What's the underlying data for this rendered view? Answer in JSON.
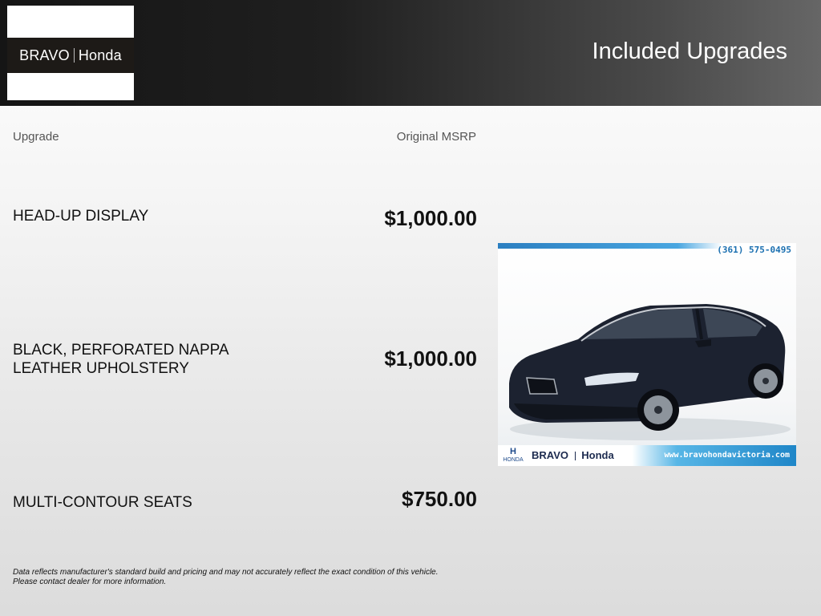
{
  "header": {
    "logo_brand": "BRAVO",
    "logo_make": "Honda",
    "title": "Included Upgrades"
  },
  "table": {
    "col_upgrade": "Upgrade",
    "col_msrp": "Original MSRP",
    "rows": [
      {
        "name_line1": "HEAD-UP DISPLAY",
        "name_line2": "",
        "price": "$1,000.00"
      },
      {
        "name_line1": "BLACK, PERFORATED NAPPA",
        "name_line2": "LEATHER UPHOLSTERY",
        "price": "$1,000.00"
      },
      {
        "name_line1": "MULTI-CONTOUR SEATS",
        "name_line2": "",
        "price": "$750.00"
      }
    ]
  },
  "photo": {
    "phone": "(361) 575-0495",
    "honda_label": "HONDA",
    "brand": "BRAVO",
    "make": "Honda",
    "website": "www.bravohondavictoria.com",
    "car_color": "#1c2230"
  },
  "disclaimer": {
    "line1": "Data reflects manufacturer's standard build and pricing and may not accurately reflect the exact condition of this vehicle.",
    "line2": "Please contact dealer for more information."
  }
}
